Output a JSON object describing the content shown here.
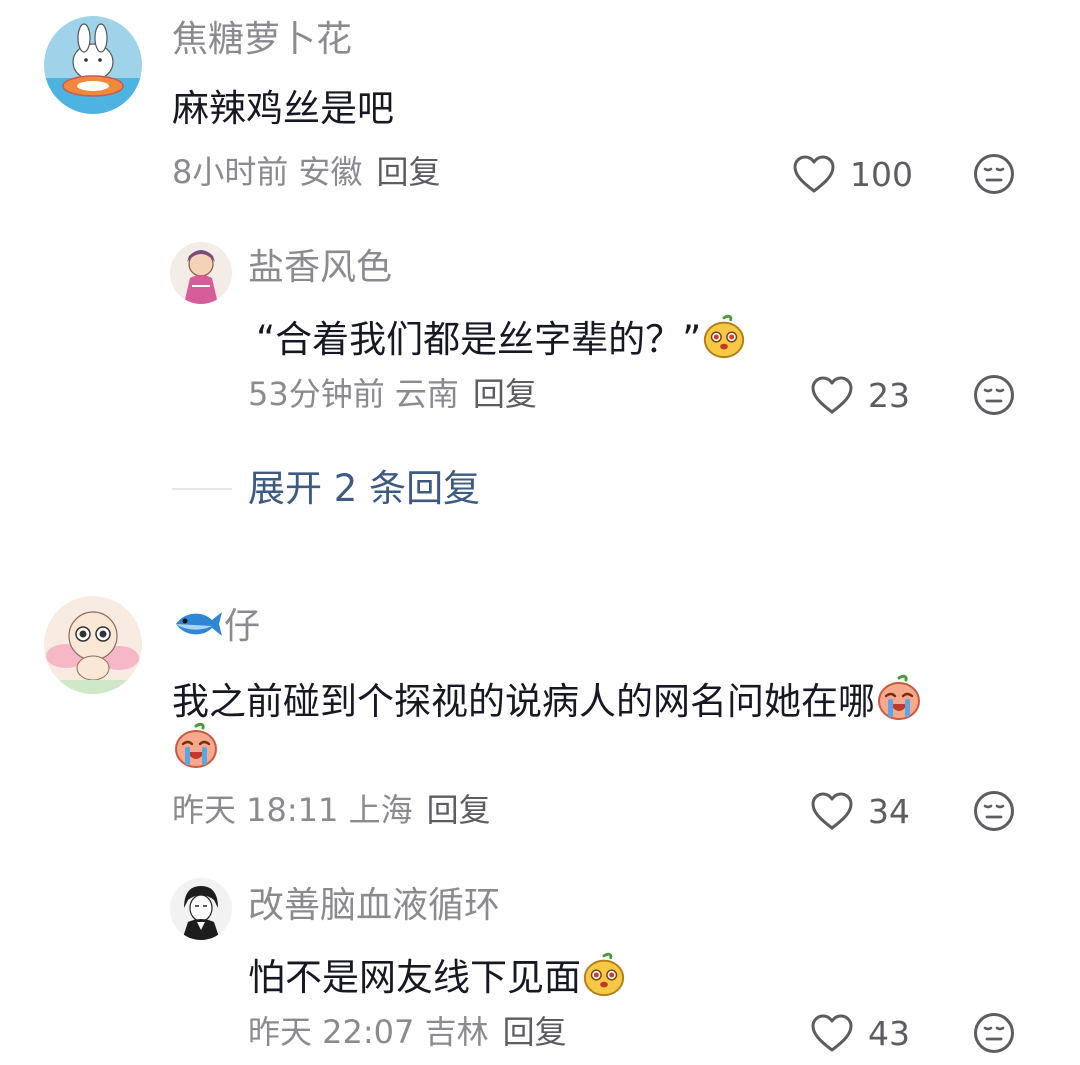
{
  "comments": [
    {
      "user": "焦糖萝卜花",
      "text": "麻辣鸡丝是吧",
      "meta": "8小时前 安徽",
      "reply_label": "回复",
      "likes": "100",
      "avatar_icon": "bunny-swim-ring-avatar",
      "replies": [
        {
          "user": "盐香风色",
          "text": "“合着我们都是丝字辈的？”",
          "meta": "53分钟前 云南",
          "reply_label": "回复",
          "likes": "23",
          "avatar_icon": "anime-girl-avatar",
          "emoji": "cute-face-emoji"
        }
      ],
      "expand_label": "展开 2 条回复"
    },
    {
      "user_icon": "fish-icon",
      "user": "仔",
      "text": "我之前碰到个探视的说病人的网名问她在哪",
      "meta": "昨天 18:11 上海",
      "reply_label": "回复",
      "likes": "34",
      "avatar_icon": "cartoon-cherub-avatar",
      "emoji": "crying-face-emoji",
      "replies": [
        {
          "user": "改善脑血液循环",
          "text": "怕不是网友线下见面",
          "meta": "昨天 22:07 吉林",
          "reply_label": "回复",
          "likes": "43",
          "avatar_icon": "manga-character-avatar",
          "emoji": "cute-face-emoji"
        }
      ]
    }
  ],
  "colors": {
    "name": "#8a8b91",
    "text": "#161823",
    "expand": "#3d5a80"
  }
}
